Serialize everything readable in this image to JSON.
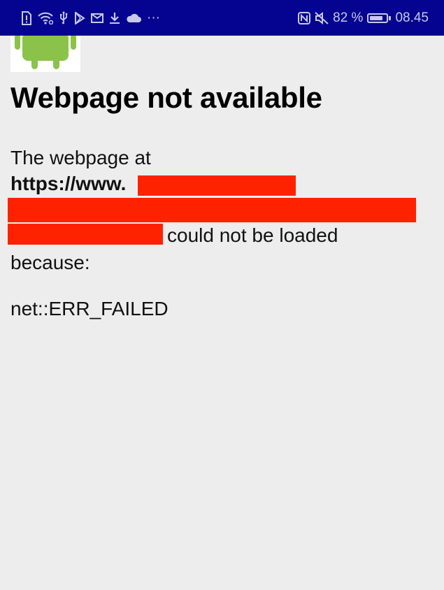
{
  "status_bar": {
    "left_icons": [
      "sim-alert-icon",
      "wifi-icon",
      "usb-icon",
      "play-store-icon",
      "mail-icon",
      "download-icon",
      "cloud-icon",
      "more-icon"
    ],
    "more_label": "···",
    "right_icons": [
      "nfc-icon",
      "mute-icon",
      "battery-icon"
    ],
    "battery_label": "82 %",
    "battery_level": 0.82,
    "time": "08.45",
    "background_color": "#050490"
  },
  "page": {
    "title": "Webpage not available",
    "message_prefix": "The webpage at",
    "url_prefix": "https://www.",
    "message_suffix": "could not be loaded",
    "message_because": "because:",
    "error_code": "net::ERR_FAILED",
    "redaction_color": "#ff2200",
    "logo_icon": "android-icon",
    "logo_color": "#8bc34a"
  }
}
